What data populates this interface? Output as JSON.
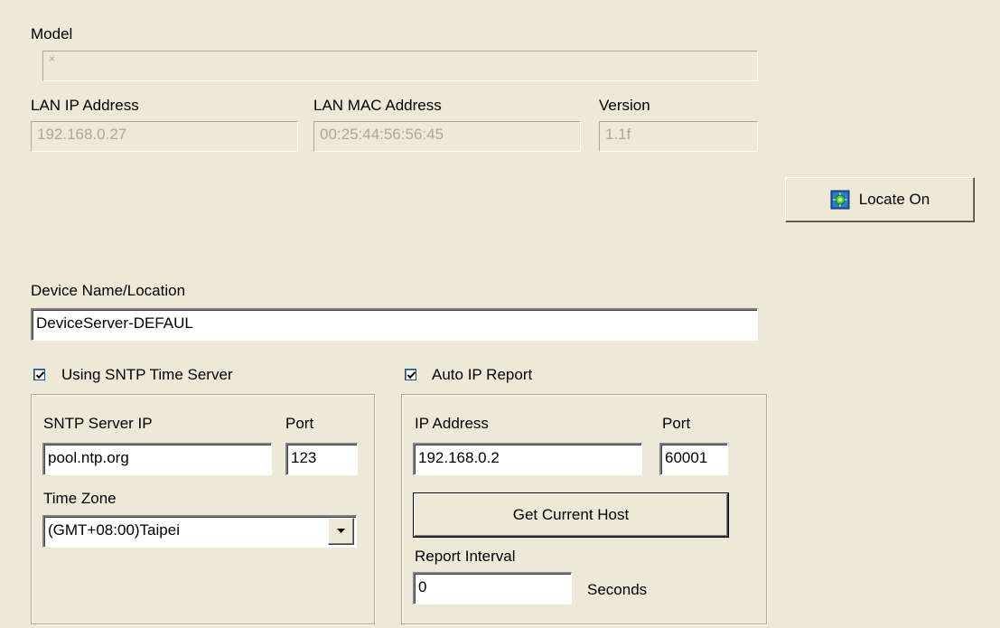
{
  "model": {
    "label": "Model",
    "value": "×"
  },
  "lan_ip": {
    "label": "LAN IP Address",
    "value": "192.168.0.27"
  },
  "lan_mac": {
    "label": "LAN MAC Address",
    "value": "00:25:44:56:56:45"
  },
  "version": {
    "label": "Version",
    "value": "1.1f"
  },
  "locate_button": {
    "label": "Locate On",
    "icon": "locate-icon"
  },
  "device_name": {
    "label": "Device Name/Location",
    "value": "DeviceServer-DEFAUL"
  },
  "sntp": {
    "checkbox_label": "Using SNTP Time Server",
    "checked": true,
    "server_ip_label": "SNTP Server IP",
    "server_ip_value": "pool.ntp.org",
    "port_label": "Port",
    "port_value": "123",
    "timezone_label": "Time Zone",
    "timezone_value": "(GMT+08:00)Taipei"
  },
  "auto_ip": {
    "checkbox_label": "Auto IP Report",
    "checked": true,
    "ip_label": "IP Address",
    "ip_value": "192.168.0.2",
    "port_label": "Port",
    "port_value": "60001",
    "get_host_label": "Get Current Host",
    "interval_label": "Report Interval",
    "interval_value": "0",
    "seconds_label": "Seconds"
  }
}
